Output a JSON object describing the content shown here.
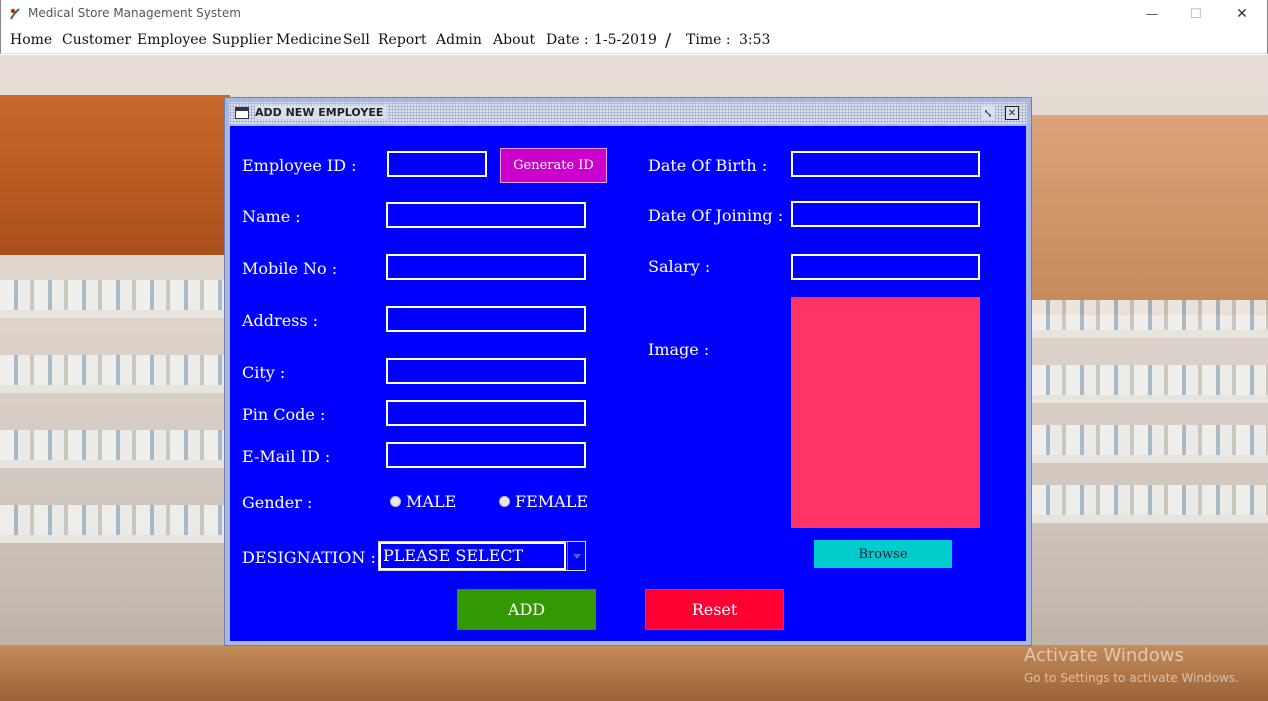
{
  "window": {
    "title": "Medical Store Management System",
    "minimize_glyph": "—",
    "maximize_glyph": "☐",
    "close_glyph": "✕"
  },
  "menubar": {
    "items": [
      "Home",
      "Customer",
      "Employee",
      "Supplier",
      "Medicine",
      "Sell",
      "Report",
      "Admin",
      "About"
    ],
    "date_label": "Date :",
    "date_value": "1-5-2019",
    "separator": "/",
    "time_label": "Time :",
    "time_value": "3:53"
  },
  "dialog": {
    "title": "ADD NEW EMPLOYEE",
    "restore_glyph": "⤡",
    "close_glyph": "✕",
    "labels": {
      "employee_id": "Employee ID :",
      "name": "Name :",
      "mobile": "Mobile No :",
      "address": "Address :",
      "city": "City :",
      "pin": "Pin Code :",
      "email": "E-Mail ID :",
      "gender": "Gender :",
      "designation": "DESIGNATION :",
      "dob": "Date Of Birth :",
      "doj": "Date Of Joining :",
      "salary": "Salary :",
      "image": "Image :"
    },
    "values": {
      "employee_id": "",
      "name": "",
      "mobile": "",
      "address": "",
      "city": "",
      "pin": "",
      "email": "",
      "dob": "",
      "doj": "",
      "salary": ""
    },
    "gender_options": {
      "male": "MALE",
      "female": "FEMALE"
    },
    "designation_selected": "PLEASE SELECT",
    "buttons": {
      "generate_id": "Generate ID",
      "browse": "Browse",
      "add": "ADD",
      "reset": "Reset"
    }
  },
  "watermark": {
    "line1": "Activate Windows",
    "line2": "Go to Settings to activate Windows."
  },
  "colors": {
    "panel": "#0000ff",
    "generate_button": "#cc00cc",
    "browse_button": "#00cccc",
    "add_button": "#339900",
    "reset_button": "#ff0033",
    "image_placeholder": "#ff3366"
  }
}
